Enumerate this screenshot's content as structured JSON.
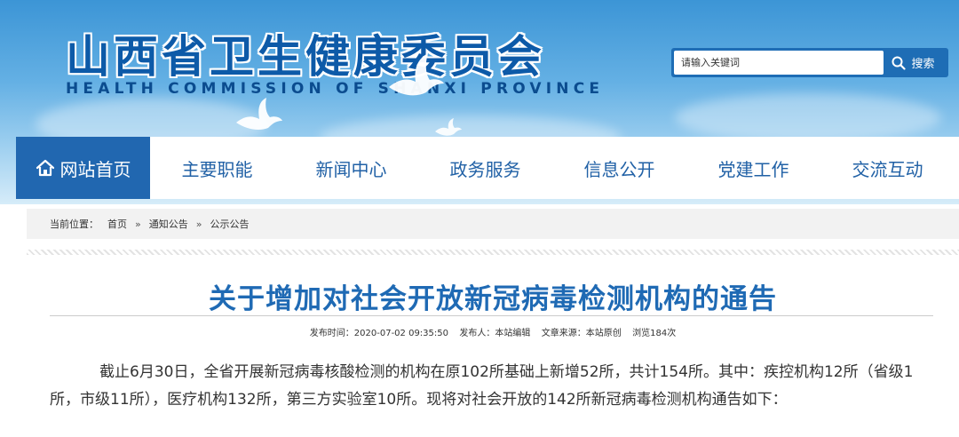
{
  "header": {
    "title": "山西省卫生健康委员会",
    "subtitle": "HEALTH COMMISSION OF SHANXI PROVINCE"
  },
  "search": {
    "placeholder": "请输入关键词",
    "button_label": "搜索"
  },
  "nav": {
    "items": [
      {
        "label": "网站首页",
        "icon": "home-icon",
        "active": true
      },
      {
        "label": "主要职能"
      },
      {
        "label": "新闻中心"
      },
      {
        "label": "政务服务"
      },
      {
        "label": "信息公开"
      },
      {
        "label": "党建工作"
      },
      {
        "label": "交流互动"
      }
    ]
  },
  "breadcrumb": {
    "prefix": "当前位置：",
    "separator": "»",
    "items": [
      "首页",
      "通知公告",
      "公示公告"
    ]
  },
  "article": {
    "title": "关于增加对社会开放新冠病毒检测机构的通告",
    "meta": {
      "published_label": "发布时间：",
      "published_value": "2020-07-02 09:35:50",
      "publisher_label": "发布人：",
      "publisher_value": "本站编辑",
      "source_label": "文章来源：",
      "source_value": "本站原创",
      "views_label": "浏览",
      "views_value": "184",
      "views_unit": "次"
    },
    "body": "截止6月30日，全省开展新冠病毒核酸检测的机构在原102所基础上新增52所，共计154所。其中：疾控机构12所（省级1所，市级11所），医疗机构132所，第三方实验室10所。现将对社会开放的142所新冠病毒检测机构通告如下："
  },
  "colors": {
    "nav_active": "#2167b0",
    "nav_text": "#2161a6",
    "title_blue": "#1f6ab4",
    "search_blue": "#1e6db5"
  }
}
